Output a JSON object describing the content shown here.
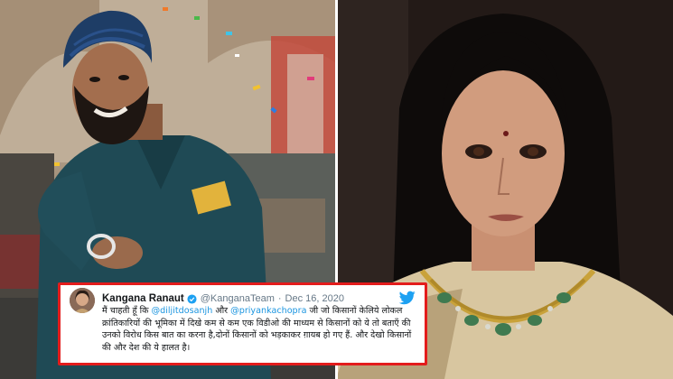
{
  "tweet": {
    "name": "Kangana Ranaut",
    "handle": "@KanganaTeam",
    "separator": "·",
    "date": "Dec 16, 2020",
    "body_part1": "मैं चाहती हूँ कि ",
    "mention1": "@diljitdosanjh",
    "body_part2": " और ",
    "mention2": "@priyankachopra",
    "body_part3": " जी जो किसानों केलिये लोकल क्रांतिकारियों की भूमिका में दिखे कम से कम एक विडीओ की माध्यम से किसानों को ये तो बताएँ की उनको विरोध किस बात का करना है,दोनों किसानों को भड़काकर ग़ायब हो गए हैं. और देखो किसानों की और देश की ये हालत है।"
  },
  "icons": {
    "verified": "verified-badge-icon",
    "twitter": "twitter-bird-icon"
  },
  "colors": {
    "tweet_border": "#e31c1c",
    "mention": "#1b95e0",
    "twitter_blue": "#1da1f2"
  }
}
